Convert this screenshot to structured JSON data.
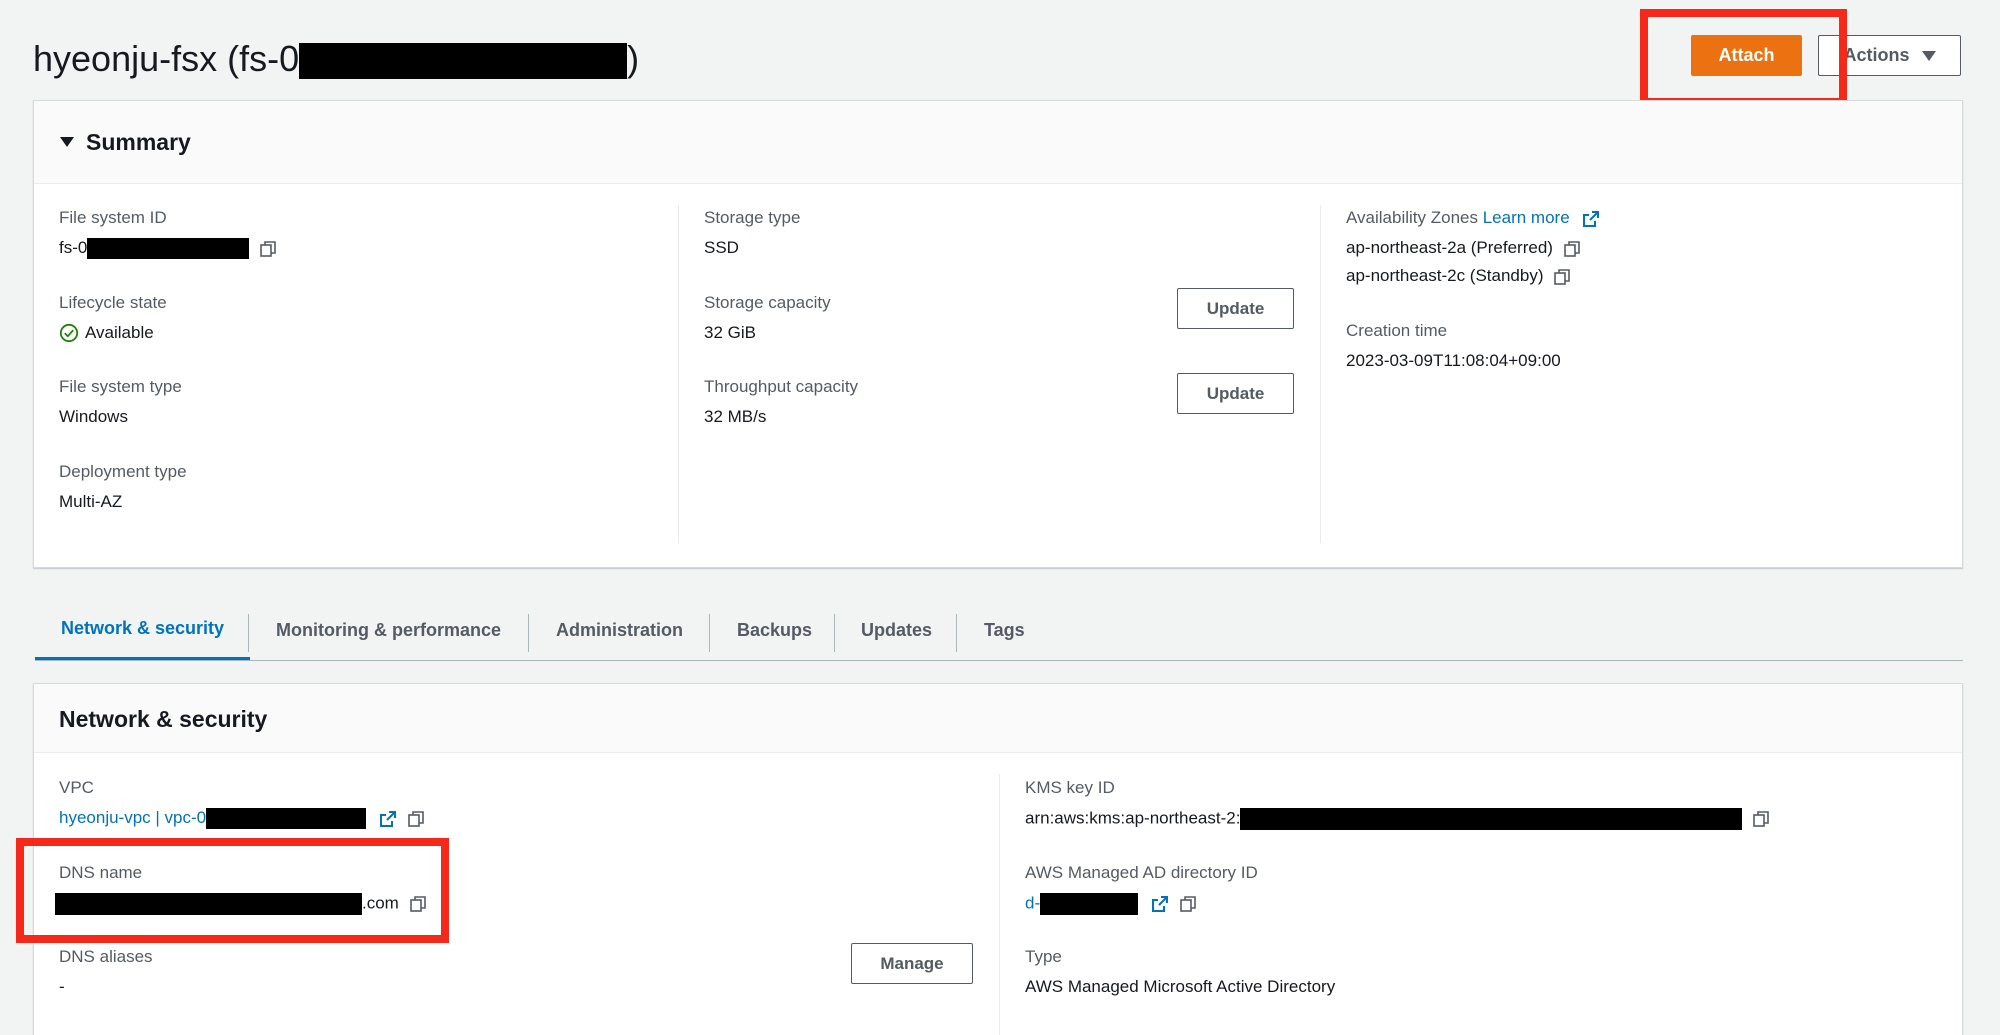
{
  "header": {
    "title_prefix": "hyeonju-fsx (fs-0",
    "title_suffix": ")",
    "attach_label": "Attach",
    "actions_label": "Actions"
  },
  "summary": {
    "title": "Summary",
    "file_system_id_label": "File system ID",
    "file_system_id_prefix": "fs-0",
    "lifecycle_label": "Lifecycle state",
    "lifecycle_value": "Available",
    "fs_type_label": "File system type",
    "fs_type_value": "Windows",
    "deployment_label": "Deployment type",
    "deployment_value": "Multi-AZ",
    "storage_type_label": "Storage type",
    "storage_type_value": "SSD",
    "storage_capacity_label": "Storage capacity",
    "storage_capacity_value": "32 GiB",
    "throughput_label": "Throughput capacity",
    "throughput_value": "32 MB/s",
    "update_label": "Update",
    "az_label": "Availability Zones",
    "learn_more": "Learn more",
    "az_1": "ap-northeast-2a (Preferred)",
    "az_2": "ap-northeast-2c (Standby)",
    "creation_label": "Creation time",
    "creation_value": "2023-03-09T11:08:04+09:00"
  },
  "tabs": [
    {
      "label": "Network & security",
      "active": true
    },
    {
      "label": "Monitoring & performance"
    },
    {
      "label": "Administration"
    },
    {
      "label": "Backups"
    },
    {
      "label": "Updates"
    },
    {
      "label": "Tags"
    }
  ],
  "network": {
    "title": "Network & security",
    "vpc_label": "VPC",
    "vpc_link_prefix": "hyeonju-vpc | vpc-0",
    "dns_label": "DNS name",
    "dns_suffix": ".com",
    "dns_aliases_label": "DNS aliases",
    "dns_aliases_value": "-",
    "manage_label": "Manage",
    "kms_label": "KMS key ID",
    "kms_prefix": "arn:aws:kms:ap-northeast-2:",
    "ad_label": "AWS Managed AD directory ID",
    "ad_prefix": "d-",
    "type_label": "Type",
    "type_value": "AWS Managed Microsoft Active Directory"
  },
  "colors": {
    "primary": "#ec7211",
    "link": "#0073bb",
    "highlight": "#f5281a",
    "success": "#1d8102"
  }
}
